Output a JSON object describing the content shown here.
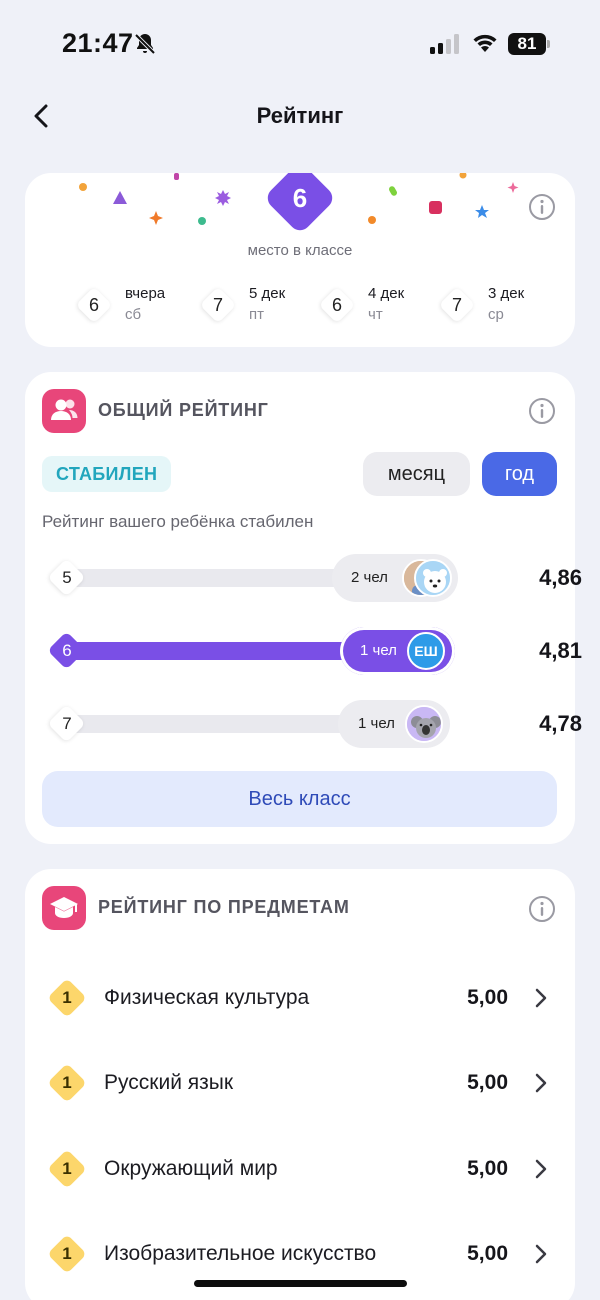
{
  "status_bar": {
    "time": "21:47",
    "battery": "81"
  },
  "header": {
    "title": "Рейтинг"
  },
  "place": {
    "value": "6",
    "caption": "место в классе",
    "history": [
      {
        "place": "6",
        "day": "вчера",
        "weekday": "сб"
      },
      {
        "place": "7",
        "day": "5 дек",
        "weekday": "пт"
      },
      {
        "place": "6",
        "day": "4 дек",
        "weekday": "чт"
      },
      {
        "place": "7",
        "day": "3 дек",
        "weekday": "ср"
      }
    ]
  },
  "general": {
    "title": "ОБЩИЙ РЕЙТИНГ",
    "badge": "СТАБИЛЕН",
    "period_month": "месяц",
    "period_year": "год",
    "selected_period": "год",
    "description": "Рейтинг вашего ребёнка стабилен",
    "rows": [
      {
        "place": "5",
        "people": "2 чел",
        "score": "4,86",
        "active": false
      },
      {
        "place": "6",
        "people": "1 чел",
        "score": "4,81",
        "active": true,
        "avatar_initials": "ЕШ"
      },
      {
        "place": "7",
        "people": "1 чел",
        "score": "4,78",
        "active": false
      }
    ],
    "whole_class": "Весь класс"
  },
  "subjects": {
    "title": "РЕЙТИНГ ПО ПРЕДМЕТАМ",
    "items": [
      {
        "place": "1",
        "name": "Физическая культура",
        "score": "5,00"
      },
      {
        "place": "1",
        "name": "Русский язык",
        "score": "5,00"
      },
      {
        "place": "1",
        "name": "Окружающий мир",
        "score": "5,00"
      },
      {
        "place": "1",
        "name": "Изобразительное искусство",
        "score": "5,00"
      }
    ]
  },
  "colors": {
    "accent_purple": "#7a4fe6",
    "accent_blue": "#4a69e6",
    "section_pink": "#e8467a",
    "stable_teal": "#22a6bd",
    "subject_gold": "#fcd66b"
  }
}
